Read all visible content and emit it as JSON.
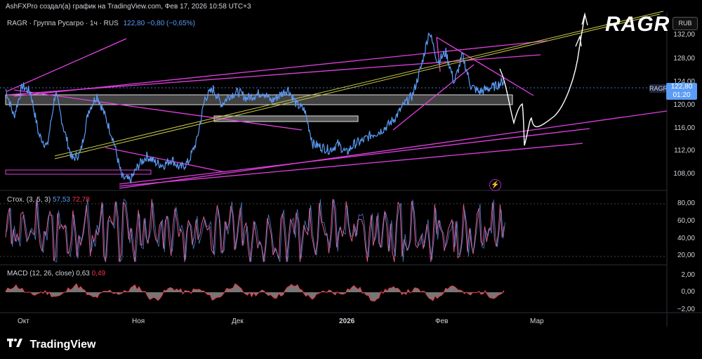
{
  "credit": "AshFXPro создал(а) график на TradingView.com, Фев 17, 2026 10:58 UTC+3",
  "legend": {
    "symbol_text": "RAGR · Группа Русагро · 1ч · RUS",
    "values": "122,80  −0,80 (−0,65%)"
  },
  "stoch": {
    "label": "Стох. (3, 5, 3)",
    "k": "57,53",
    "d": "72,78"
  },
  "macd": {
    "label": "MACD (12, 26, close)",
    "macd": "0,63",
    "signal": "0,49"
  },
  "currency_button": "RUB",
  "annotation_text": "RAGR",
  "price_tag": {
    "symbol": "RAGR",
    "price": "122,80",
    "timer": "01:20"
  },
  "logo_text": "TradingView",
  "colors": {
    "price": "#5b9cf6",
    "trendline": "#e040e0",
    "yellow_line": "#c8c84a",
    "zone": "#9e9e9e",
    "stoch": "#e05b8a",
    "macd_fill": "#9e9e9e"
  },
  "chart_data": [
    {
      "type": "line",
      "name": "price-panel",
      "yaxis_ticks": [
        "132,00",
        "128,00",
        "124,00",
        "120,00",
        "116,00",
        "112,00",
        "108,00"
      ],
      "ylim": [
        105,
        134
      ],
      "xaxis_ticks": [
        "Окт",
        "Ноя",
        "Дек",
        "2026",
        "Фев",
        "Мар"
      ],
      "series": [
        {
          "values": [
            121.5,
            117.0,
            122.0,
            121.0,
            114.0,
            112.0,
            121.0,
            115.0,
            110.0,
            111.0,
            118.0,
            120.5,
            117.0,
            113.0,
            107.0,
            106.5,
            109.0,
            110.5,
            109.5,
            109.0,
            110.0,
            108.5,
            109.5,
            113.0,
            120.0,
            121.5,
            119.0,
            120.5,
            121.0,
            120.0,
            120.5,
            121.0,
            119.5,
            120.5,
            121.5,
            119.0,
            118.0,
            112.5,
            112.0,
            111.5,
            112.5,
            111.0,
            112.5,
            113.0,
            114.0,
            114.5,
            115.5,
            117.0,
            119.0,
            120.5,
            125.0,
            131.0,
            126.0,
            127.5,
            122.5,
            127.0,
            122.0,
            121.0,
            121.5,
            122.0,
            122.8
          ]
        }
      ],
      "levels": [
        "120,00",
        "123,00"
      ]
    },
    {
      "type": "line",
      "name": "stochastic-panel",
      "yaxis_ticks": [
        "80,00",
        "60,00",
        "40,00",
        "20,00"
      ],
      "ylim": [
        10,
        95
      ]
    },
    {
      "type": "area",
      "name": "macd-panel",
      "yaxis_ticks": [
        "2,00",
        "0,00",
        "−2,00"
      ],
      "ylim": [
        -3,
        3
      ]
    }
  ]
}
